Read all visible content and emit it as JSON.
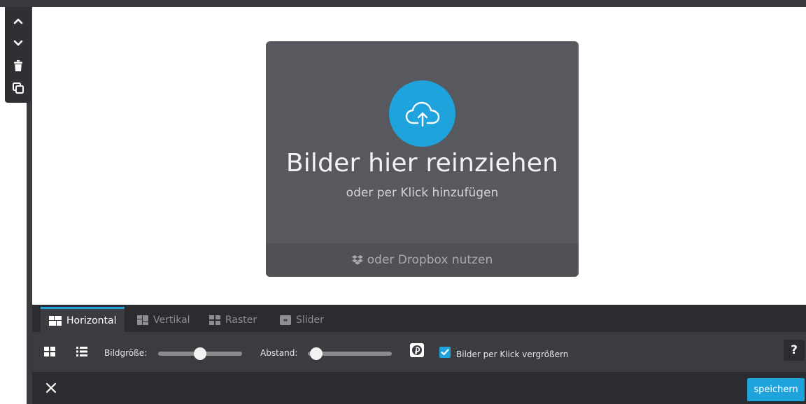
{
  "side_toolbar": {
    "icons": [
      "chevron-up-icon",
      "chevron-down-icon",
      "trash-icon",
      "duplicate-icon"
    ]
  },
  "dropzone": {
    "title": "Bilder hier reinziehen",
    "subtitle": "oder per Klick hinzufügen",
    "dropbox_label": "oder Dropbox nutzen",
    "icon": "cloud-upload-icon"
  },
  "tabs": [
    {
      "label": "Horizontal",
      "active": true
    },
    {
      "label": "Vertikal",
      "active": false
    },
    {
      "label": "Raster",
      "active": false
    },
    {
      "label": "Slider",
      "active": false
    }
  ],
  "options": {
    "image_size_label": "Bildgröße:",
    "image_size_value": 0.5,
    "spacing_label": "Abstand:",
    "spacing_value": 0.1,
    "zoom_on_click_label": "Bilder per Klick vergrößern",
    "zoom_on_click_checked": true,
    "help_label": "?"
  },
  "footer": {
    "save_label": "speichern"
  },
  "colors": {
    "accent": "#1ea3dc",
    "dark_bar": "#2b2c2f",
    "options_bar": "#3b3c40",
    "dropzone": "#58595e"
  }
}
